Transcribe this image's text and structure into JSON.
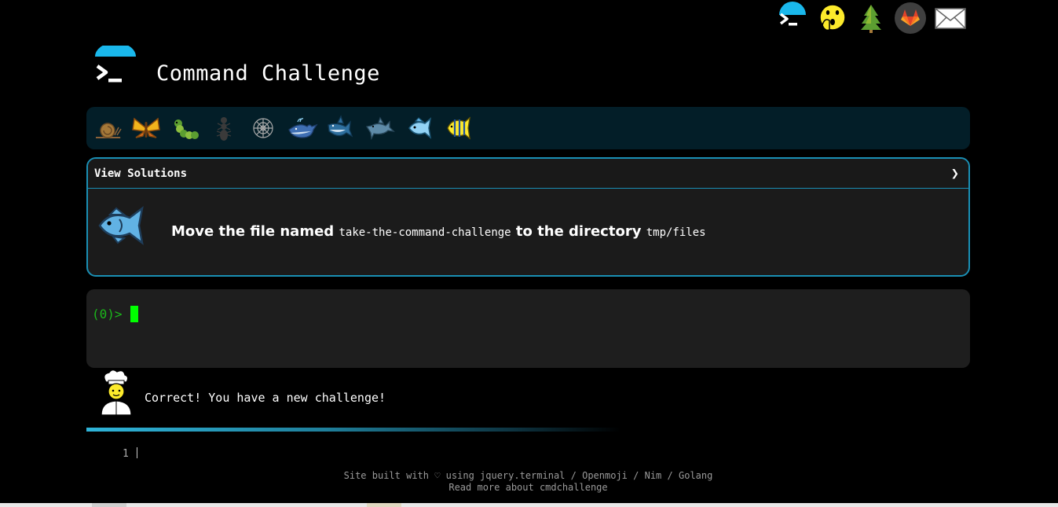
{
  "header": {
    "title": "Command Challenge",
    "logo_icon": "terminal-logo-icon"
  },
  "top_nav": [
    {
      "name": "terminal-icon"
    },
    {
      "name": "shushing-face-icon"
    },
    {
      "name": "tree-icon"
    },
    {
      "name": "gitlab-icon"
    },
    {
      "name": "envelope-icon"
    }
  ],
  "levels": [
    {
      "name": "snail-icon"
    },
    {
      "name": "butterfly-icon"
    },
    {
      "name": "caterpillar-icon"
    },
    {
      "name": "ant-icon"
    },
    {
      "name": "spider-web-icon"
    },
    {
      "name": "whale-icon"
    },
    {
      "name": "shark-icon"
    },
    {
      "name": "dolphin-icon"
    },
    {
      "name": "fish-icon",
      "active": true
    },
    {
      "name": "tropical-fish-icon"
    }
  ],
  "panel": {
    "header_label": "View Solutions",
    "chevron": "❯",
    "task_prefix": "Move the file named",
    "task_file": "take-the-command-challenge",
    "task_middle": "to the directory",
    "task_dir": "tmp/files"
  },
  "terminal": {
    "prompt": "(0)>"
  },
  "feedback": {
    "message": "Correct! You have a new challenge!"
  },
  "editor": {
    "line_number": "1"
  },
  "footer": {
    "built_prefix": "Site built with ♡ using",
    "links": [
      "jquery.terminal",
      "Openmoji",
      "Nim",
      "Golang"
    ],
    "separator": "/",
    "read_more": "Read more about cmdchallenge"
  },
  "colors": {
    "accent": "#1a8fb4",
    "prompt": "#1bb81b",
    "cursor": "#00ff00",
    "level_bar": "#031e28",
    "panel_bg": "#1b1b1b"
  }
}
